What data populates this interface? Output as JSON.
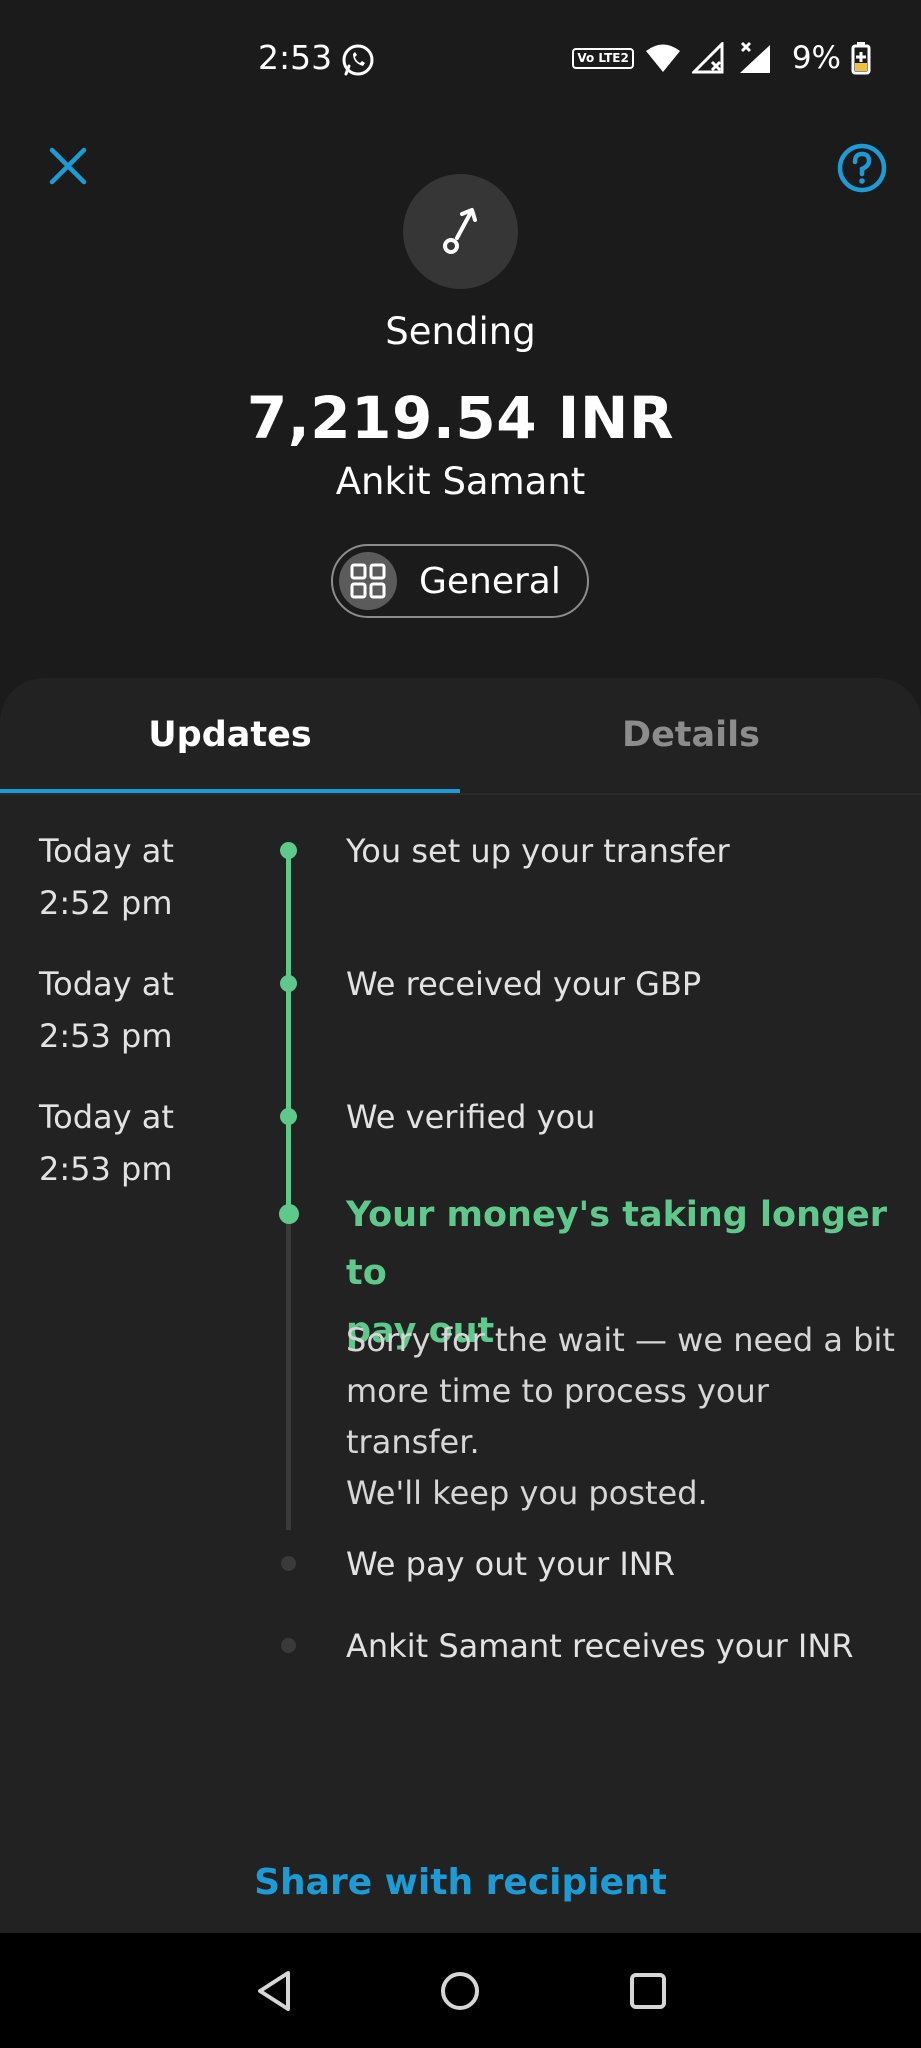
{
  "status_bar": {
    "time": "2:53",
    "volte_label": "Vo LTE2",
    "battery": "9%"
  },
  "header": {
    "close_icon": "close-icon",
    "help_icon": "help-icon",
    "transfer_icon": "send-arrow-icon"
  },
  "transfer": {
    "status": "Sending",
    "amount": "7,219.54 INR",
    "recipient": "Ankit Samant",
    "category": "General"
  },
  "tabs": [
    {
      "label": "Updates",
      "active": true
    },
    {
      "label": "Details",
      "active": false
    }
  ],
  "timeline": [
    {
      "time_line1": "Today at",
      "time_line2": "2:52 pm",
      "text": "You set up your transfer",
      "state": "done"
    },
    {
      "time_line1": "Today at",
      "time_line2": "2:53 pm",
      "text": "We received your GBP",
      "state": "done"
    },
    {
      "time_line1": "Today at",
      "time_line2": "2:53 pm",
      "text": "We verified you",
      "state": "done"
    },
    {
      "heading_line1": "Your money's taking longer to",
      "heading_line2": "pay out",
      "desc_line1": "Sorry for the wait — we need a bit",
      "desc_line2": "more time to process your transfer.",
      "desc_line3": "We'll keep you posted.",
      "state": "current"
    },
    {
      "text": "We pay out your INR",
      "state": "pending"
    },
    {
      "text": "Ankit Samant receives your INR",
      "state": "pending"
    }
  ],
  "share_link": "Share with recipient",
  "colors": {
    "accent": "#1d9bd4",
    "success": "#5ec98a",
    "background": "#1b1b1b",
    "sheet": "#222222"
  },
  "nav": [
    "back-icon",
    "home-icon",
    "recents-icon"
  ]
}
